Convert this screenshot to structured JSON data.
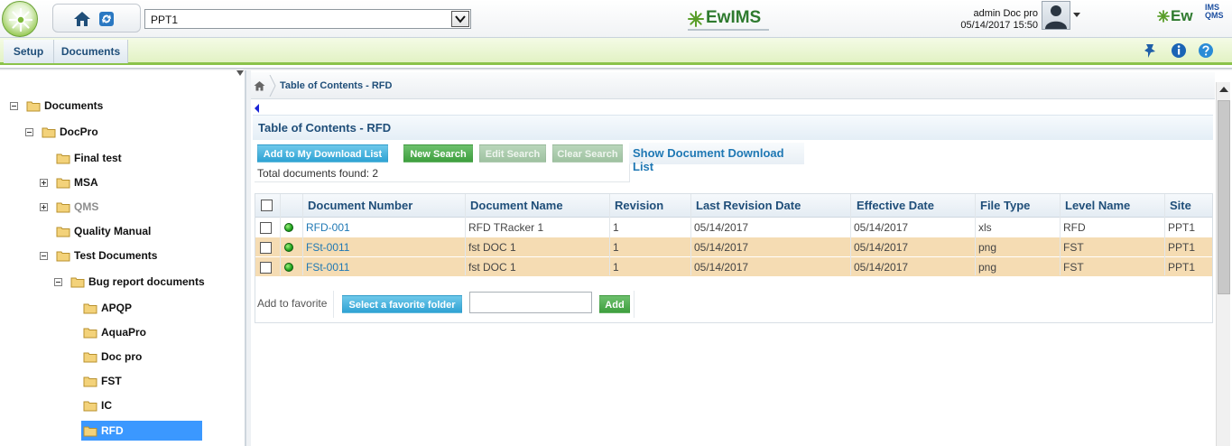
{
  "header": {
    "site_selected": "PPT1",
    "brand_center": "EwIMS",
    "brand_right": "Ew",
    "brand_right_sub": "IMS QMS",
    "user_name": "admin Doc pro",
    "user_datetime": "05/14/2017 15:50"
  },
  "menu": {
    "tabs": [
      {
        "label": "Setup"
      },
      {
        "label": "Documents"
      }
    ]
  },
  "tree": {
    "nodes": [
      {
        "label": "Documents"
      },
      {
        "label": "DocPro"
      },
      {
        "label": "Final test"
      },
      {
        "label": "MSA"
      },
      {
        "label": "QMS"
      },
      {
        "label": "Quality Manual"
      },
      {
        "label": "Test Documents"
      },
      {
        "label": "Bug report documents"
      },
      {
        "label": "APQP"
      },
      {
        "label": "AquaPro"
      },
      {
        "label": "Doc pro"
      },
      {
        "label": "FST"
      },
      {
        "label": "IC"
      },
      {
        "label": "RFD"
      }
    ]
  },
  "breadcrumb": {
    "text": "Table of Contents - RFD"
  },
  "section": {
    "title": "Table of Contents - RFD"
  },
  "toolbar": {
    "add_download": "Add to My Download List",
    "new_search": "New Search",
    "edit_search": "Edit Search",
    "clear_search": "Clear Search",
    "show_download": "Show Document Download List",
    "total": "Total documents found: 2"
  },
  "table": {
    "columns": [
      "Document Number",
      "Document Name",
      "Revision",
      "Last Revision Date",
      "Effective Date",
      "File Type",
      "Level Name",
      "Site"
    ],
    "rows": [
      [
        "RFD-001",
        "RFD TRacker 1",
        "1",
        "05/14/2017",
        "05/14/2017",
        "xls",
        "RFD",
        "PPT1"
      ],
      [
        "FSt-0011",
        "fst DOC 1",
        "1",
        "05/14/2017",
        "05/14/2017",
        "png",
        "FST",
        "PPT1"
      ],
      [
        "FSt-0011",
        "fst DOC 1",
        "1",
        "05/14/2017",
        "05/14/2017",
        "png",
        "FST",
        "PPT1"
      ]
    ]
  },
  "favorite": {
    "label": "Add to favorite",
    "select_button": "Select a favorite folder",
    "input_value": "",
    "add_button": "Add"
  },
  "colors": {
    "accent": "#1f4e79",
    "link": "#1f78b4",
    "menu_green": "#8bc34a",
    "row_highlight": "#f5dcb3",
    "selected_node": "#3b98ff"
  }
}
